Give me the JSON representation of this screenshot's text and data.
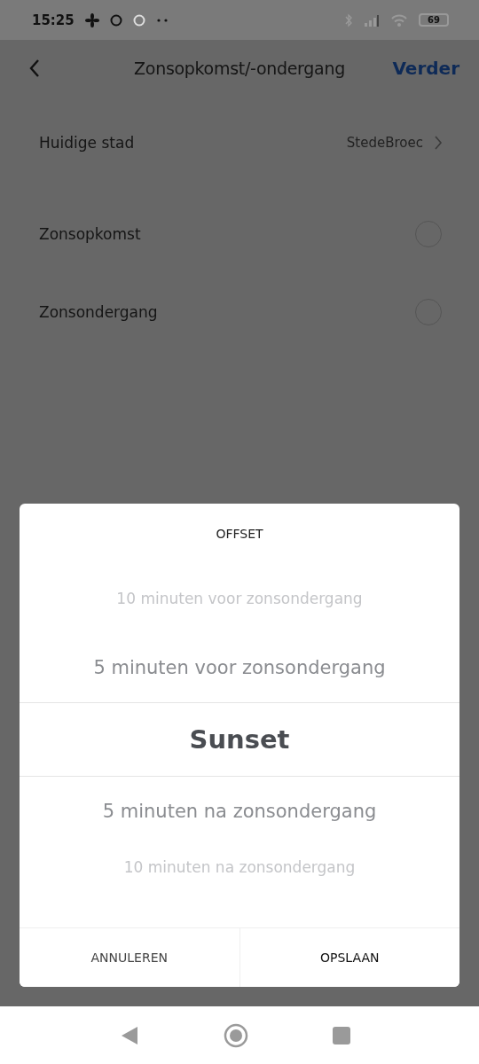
{
  "status_bar": {
    "time": "15:25",
    "battery": "69"
  },
  "header": {
    "title": "Zonsopkomst/-ondergang",
    "action": "Verder"
  },
  "city": {
    "label": "Huidige stad",
    "value": "StedeBroec"
  },
  "options": [
    {
      "label": "Zonsopkomst",
      "selected": false
    },
    {
      "label": "Zonsondergang",
      "selected": false
    }
  ],
  "dialog": {
    "title": "OFFSET",
    "items": [
      {
        "label": "10 minuten voor zonsondergang",
        "selected": false
      },
      {
        "label": "5 minuten voor zonsondergang",
        "selected": false
      },
      {
        "label": "Sunset",
        "selected": true
      },
      {
        "label": "5 minuten na zonsondergang",
        "selected": false
      },
      {
        "label": "10 minuten na zonsondergang",
        "selected": false
      }
    ],
    "buttons": [
      "ANNULEREN",
      "OPSLAAN"
    ]
  }
}
